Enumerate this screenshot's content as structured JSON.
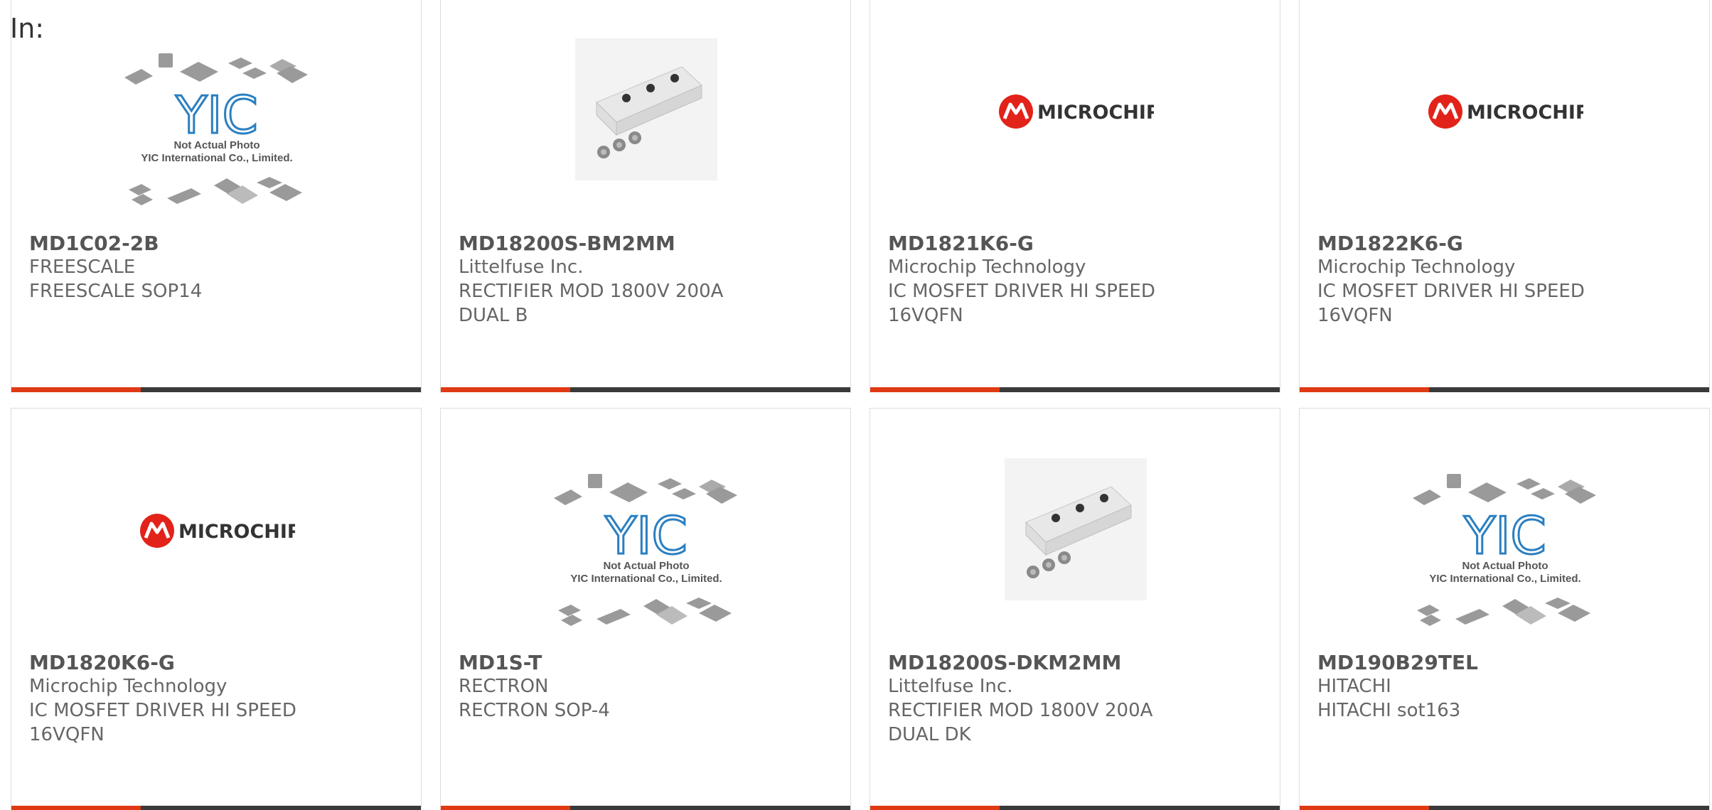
{
  "prefix": "In:",
  "colors": {
    "accent": "#e03a14",
    "bar": "#3a3a3a",
    "microchip_red": "#e2231a"
  },
  "placeholder_text": {
    "brand": "YIC",
    "line1": "Not Actual Photo",
    "line2": "YIC International Co., Limited."
  },
  "logo_text": "MICROCHIP",
  "cards": [
    {
      "part": "MD1C02-2B",
      "manufacturer": "FREESCALE",
      "desc1": "FREESCALE SOP14",
      "desc2": "",
      "image": "placeholder-image"
    },
    {
      "part": "MD18200S-BM2MM",
      "manufacturer": "Littelfuse Inc.",
      "desc1": "RECTIFIER MOD 1800V 200A",
      "desc2": "DUAL B",
      "image": "module-photo"
    },
    {
      "part": "MD1821K6-G",
      "manufacturer": "Microchip Technology",
      "desc1": "IC MOSFET DRIVER HI SPEED",
      "desc2": "16VQFN",
      "image": "microchip-logo"
    },
    {
      "part": "MD1822K6-G",
      "manufacturer": "Microchip Technology",
      "desc1": "IC MOSFET DRIVER HI SPEED",
      "desc2": "16VQFN",
      "image": "microchip-logo"
    },
    {
      "part": "MD1820K6-G",
      "manufacturer": "Microchip Technology",
      "desc1": "IC MOSFET DRIVER HI SPEED",
      "desc2": "16VQFN",
      "image": "microchip-logo"
    },
    {
      "part": "MD1S-T",
      "manufacturer": "RECTRON",
      "desc1": "RECTRON SOP-4",
      "desc2": "",
      "image": "placeholder-image"
    },
    {
      "part": "MD18200S-DKM2MM",
      "manufacturer": "Littelfuse Inc.",
      "desc1": "RECTIFIER MOD 1800V 200A",
      "desc2": "DUAL DK",
      "image": "module-photo"
    },
    {
      "part": "MD190B29TEL",
      "manufacturer": "HITACHI",
      "desc1": "HITACHI sot163",
      "desc2": "",
      "image": "placeholder-image"
    }
  ]
}
